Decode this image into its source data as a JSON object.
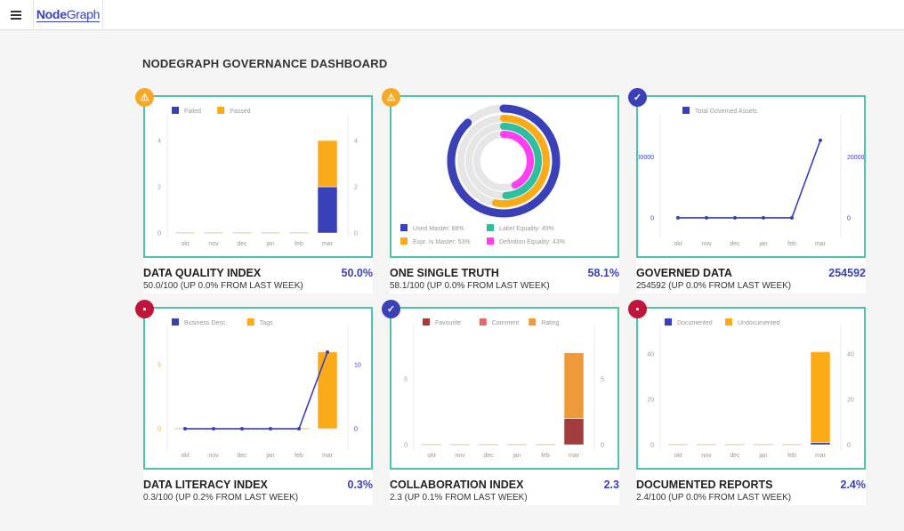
{
  "app": {
    "logo_text_bold": "Node",
    "logo_text_light": "Graph",
    "menu_icon": "hamburger-icon"
  },
  "page_title": "NODEGRAPH GOVERNANCE DASHBOARD",
  "colors": {
    "accent": "#3940b8",
    "card_border": "#4dc5a8",
    "warning": "#f9a825",
    "ok": "#3940b8",
    "alert": "#c0143c"
  },
  "cards": [
    {
      "title": "DATA QUALITY INDEX",
      "value": "50.0%",
      "subtitle": "50.0/100 (UP 0.0% FROM LAST WEEK)",
      "status_icon": "warning-icon"
    },
    {
      "title": "ONE SINGLE TRUTH",
      "value": "58.1%",
      "subtitle": "58.1/100 (UP 0.0% FROM LAST WEEK)",
      "status_icon": "warning-icon"
    },
    {
      "title": "GOVERNED DATA",
      "value": "254592",
      "subtitle": "254592 (UP 0.0% FROM LAST WEEK)",
      "status_icon": "check-icon"
    },
    {
      "title": "DATA LITERACY INDEX",
      "value": "0.3%",
      "subtitle": "0.3/100 (UP 0.2% FROM LAST WEEK)",
      "status_icon": "comment-icon"
    },
    {
      "title": "COLLABORATION INDEX",
      "value": "2.3",
      "subtitle": "2.3 (UP 0.1% FROM LAST WEEK)",
      "status_icon": "check-icon"
    },
    {
      "title": "DOCUMENTED REPORTS",
      "value": "2.4%",
      "subtitle": "2.4/100 (UP 0.0% FROM LAST WEEK)",
      "status_icon": "comment-icon"
    }
  ],
  "chart_data": [
    {
      "type": "bar",
      "stacked": true,
      "categories": [
        "okt",
        "nov",
        "dec",
        "jan",
        "feb",
        "mar"
      ],
      "ylim": [
        0,
        5
      ],
      "yticks": [
        0,
        2,
        4
      ],
      "right_ticks": [
        0,
        2,
        4
      ],
      "legend": "top-left",
      "series": [
        {
          "name": "Failed",
          "color": "#3940b8",
          "values": [
            0,
            0,
            0,
            0,
            0,
            2
          ]
        },
        {
          "name": "Passed",
          "color": "#fbab18",
          "values": [
            0,
            0,
            0,
            0,
            0,
            2
          ]
        }
      ]
    },
    {
      "type": "radial",
      "legend": "bottom",
      "series": [
        {
          "name": "Used Master: 88%",
          "value": 88,
          "color": "#3940b8"
        },
        {
          "name": "Expr. Is Master: 53%",
          "value": 53,
          "color": "#fbab18"
        },
        {
          "name": "Label Equality: 49%",
          "value": 49,
          "color": "#2ebfa0"
        },
        {
          "name": "Definition Equality: 43%",
          "value": 43,
          "color": "#ff3ff0"
        }
      ]
    },
    {
      "type": "line",
      "categories": [
        "okt",
        "nov",
        "dec",
        "jan",
        "feb",
        "mar"
      ],
      "ylim": [
        -50000,
        330000
      ],
      "yticks": [
        0,
        200000
      ],
      "right_ticks": [
        0,
        200000
      ],
      "tick_color": "#3940b8",
      "legend": "top-left",
      "series": [
        {
          "name": "Total Governed Assets",
          "color": "#3940b8",
          "values": [
            0,
            0,
            0,
            0,
            0,
            254592
          ]
        }
      ]
    },
    {
      "type": "combo",
      "categories": [
        "okt",
        "nov",
        "dec",
        "jan",
        "feb",
        "mar"
      ],
      "ylim": [
        -1.25,
        7.8
      ],
      "yticks": [
        0,
        5
      ],
      "tick_color": "#fbab18",
      "right_ylim": [
        -2.5,
        15.6
      ],
      "right_ticks": [
        0,
        10
      ],
      "right_tick_color": "#3940b8",
      "legend": "top-left",
      "series": [
        {
          "name": "Business Desc.",
          "type": "line",
          "axis": "right",
          "color": "#3940b8",
          "values": [
            0,
            0,
            0,
            0,
            0,
            12
          ]
        },
        {
          "name": "Tags",
          "type": "bar",
          "axis": "left",
          "color": "#fbab18",
          "values": [
            0,
            0,
            0,
            0,
            0,
            6
          ]
        }
      ]
    },
    {
      "type": "bar",
      "stacked": true,
      "categories": [
        "okt",
        "nov",
        "dec",
        "jan",
        "feb",
        "mar"
      ],
      "ylim": [
        0,
        8.8
      ],
      "yticks": [
        0,
        5
      ],
      "right_ticks": [
        0,
        5
      ],
      "legend": "top-left",
      "series": [
        {
          "name": "Favourite",
          "color": "#a33d3d",
          "values": [
            0,
            0,
            0,
            0,
            0,
            2
          ]
        },
        {
          "name": "Comment",
          "color": "#df6a6a",
          "values": [
            0,
            0,
            0,
            0,
            0,
            0
          ]
        },
        {
          "name": "Rating",
          "color": "#ef9a3a",
          "values": [
            0,
            0,
            0,
            0,
            0,
            5
          ]
        }
      ]
    },
    {
      "type": "bar",
      "stacked": true,
      "categories": [
        "okt",
        "nov",
        "dec",
        "jan",
        "feb",
        "mar"
      ],
      "ylim": [
        0,
        51
      ],
      "yticks": [
        0,
        20,
        40
      ],
      "right_ticks": [
        0,
        20,
        40
      ],
      "legend": "top-left",
      "series": [
        {
          "name": "Documented",
          "color": "#3940b8",
          "values": [
            0,
            0,
            0,
            0,
            0,
            1
          ]
        },
        {
          "name": "Undocumented",
          "color": "#fbab18",
          "values": [
            0,
            0,
            0,
            0,
            0,
            40
          ]
        }
      ]
    }
  ]
}
